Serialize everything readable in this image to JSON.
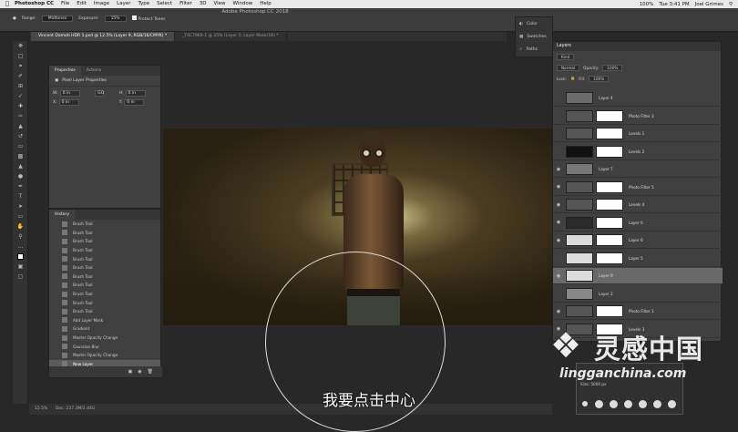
{
  "menubar": {
    "apple": "",
    "items": [
      "Photoshop CC",
      "File",
      "Edit",
      "Image",
      "Layer",
      "Type",
      "Select",
      "Filter",
      "3D",
      "View",
      "Window",
      "Help"
    ],
    "right": {
      "battery": "100%",
      "time": "Tue 3:41 PM",
      "user": "Joel Grimes"
    }
  },
  "app_title": "Adobe Photoshop CC 2018",
  "options": {
    "range_label": "Range:",
    "range_value": "Midtones",
    "exposure_label": "Exposure:",
    "exposure_value": "15%",
    "protect_tones": "Protect Tones"
  },
  "tabs": [
    {
      "label": "Vincent Damoti HDR 1.psd @ 12.5% (Layer 9, RGB/16/CMYK) *"
    },
    {
      "label": "_T4C7969-1 @ 25% (Layer 0, Layer Mask/16) *"
    }
  ],
  "side_icons": [
    {
      "label": "Color"
    },
    {
      "label": "Swatches"
    },
    {
      "label": "Paths"
    }
  ],
  "properties": {
    "tabs": [
      "Properties",
      "Actions"
    ],
    "header": "Pixel Layer Properties",
    "fields": [
      {
        "label": "W:",
        "value": "0 in"
      },
      {
        "label": "GO",
        "value": ""
      },
      {
        "label": "H:",
        "value": "0 in"
      },
      {
        "label": "X:",
        "value": "0 in"
      },
      {
        "label": "",
        "value": ""
      },
      {
        "label": "Y:",
        "value": "0 in"
      }
    ]
  },
  "history": {
    "title": "History",
    "items": [
      "Brush Tool",
      "Brush Tool",
      "Brush Tool",
      "Brush Tool",
      "Brush Tool",
      "Brush Tool",
      "Brush Tool",
      "Brush Tool",
      "Brush Tool",
      "Brush Tool",
      "Brush Tool",
      "Add Layer Mask",
      "Gradient",
      "Master Opacity Change",
      "Gaussian Blur",
      "Master Opacity Change",
      "New Layer"
    ],
    "selected_index": 16
  },
  "layers": {
    "title": "Layers",
    "kind": "Kind",
    "blend": "Normal",
    "opacity_label": "Opacity:",
    "opacity": "100%",
    "lock_label": "Lock:",
    "fill_label": "Fill:",
    "fill": "100%",
    "items": [
      {
        "name": "Layer 4",
        "eye": false,
        "mask": false,
        "thumb": "#6b6b6b"
      },
      {
        "name": "Photo Filter 3",
        "eye": false,
        "mask": true,
        "thumb": "#555"
      },
      {
        "name": "Levels 1",
        "eye": false,
        "mask": true,
        "thumb": "#555"
      },
      {
        "name": "Levels 2",
        "eye": false,
        "mask": true,
        "thumb": "#111"
      },
      {
        "name": "Layer 7",
        "eye": true,
        "mask": false,
        "thumb": "#777"
      },
      {
        "name": "Photo Filter 5",
        "eye": true,
        "mask": true,
        "thumb": "#555"
      },
      {
        "name": "Levels 4",
        "eye": true,
        "mask": true,
        "thumb": "#555"
      },
      {
        "name": "Layer 0",
        "eye": true,
        "mask": true,
        "thumb": "#2a2a2a"
      },
      {
        "name": "Layer 6",
        "eye": true,
        "mask": true,
        "thumb": "#dcdcdc"
      },
      {
        "name": "Layer 5",
        "eye": false,
        "mask": true,
        "thumb": "#dcdcdc"
      },
      {
        "name": "Layer 9",
        "eye": true,
        "mask": false,
        "thumb": "#dcdcdc"
      },
      {
        "name": "Layer 2",
        "eye": false,
        "mask": false,
        "thumb": "#888"
      },
      {
        "name": "Photo Filter 1",
        "eye": true,
        "mask": true,
        "thumb": "#555"
      },
      {
        "name": "Levels 3",
        "eye": true,
        "mask": true,
        "thumb": "#555"
      }
    ],
    "selected_index": 10
  },
  "brush": {
    "size_label": "Size:",
    "size_value": "5000 px"
  },
  "status": {
    "zoom": "12.5%",
    "doc": "Doc: 237.3M/2.44G"
  },
  "subtitle": "我要点击中心",
  "watermark": {
    "brand_cn": "灵感中国",
    "url": "lingganchina.com"
  }
}
